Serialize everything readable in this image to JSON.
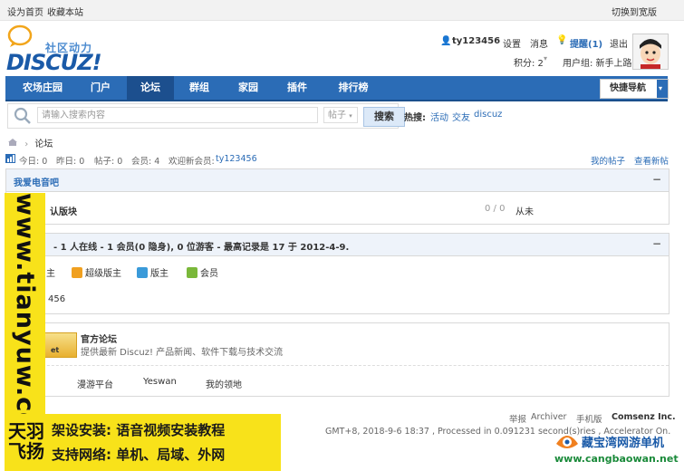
{
  "topbar": {
    "set_home": "设为首页",
    "bookmark": "收藏本站",
    "switch_width": "切换到宽版"
  },
  "header": {
    "logo_subtitle": "社区动力",
    "logo_text": "DISCUZ!",
    "username": "ty123456",
    "settings": "设置",
    "messages": "消息",
    "reminder": "提醒(1)",
    "logout": "退出",
    "points": "积分: 2",
    "usergroup": "用户组: 新手上路"
  },
  "nav": {
    "items": [
      {
        "label": "农场庄园"
      },
      {
        "label": "门户"
      },
      {
        "label": "论坛"
      },
      {
        "label": "群组"
      },
      {
        "label": "家园"
      },
      {
        "label": "插件"
      },
      {
        "label": "排行榜"
      }
    ],
    "active": "论坛",
    "quick_nav": "快捷导航"
  },
  "search": {
    "placeholder": "请输入搜索内容",
    "type": "帖子",
    "button": "搜索",
    "hot_label": "热搜:",
    "hot_words": [
      "活动",
      "交友",
      "discuz"
    ]
  },
  "breadcrumb": {
    "current": "论坛"
  },
  "stats": {
    "today": "今日: 0",
    "yesterday": "昨日: 0",
    "posts": "帖子: 0",
    "members": "会员: 4",
    "welcome": "欢迎新会员:",
    "new_member": "ty123456",
    "my_posts": "我的帖子",
    "new_posts": "查看新帖"
  },
  "forum_box": {
    "title": "我爱电音吧",
    "forum_name": "认版块",
    "counts": "0 / 0",
    "last_post": "从未"
  },
  "online_box": {
    "title": "- 1 人在线 - 1 会员(0 隐身), 0 位游客 - 最高记录是 17 于 2012-4-9.",
    "roles": [
      {
        "label": "超级版主",
        "color": "#f0a020"
      },
      {
        "label": "版主",
        "color": "#3a9ad9"
      },
      {
        "label": "会员",
        "color": "#7ab83a"
      }
    ],
    "role_cutoff": "主",
    "online_user": "456"
  },
  "links_box": {
    "site_title": "官方论坛",
    "site_desc": "提供最新 Discuz! 产品新闻、软件下载与技术交流",
    "links": [
      "漫游平台",
      "Yeswan",
      "我的领地"
    ]
  },
  "footer": {
    "report": "举报",
    "archiver": "Archiver",
    "mobile": "手机版",
    "company": "Comsenz Inc.",
    "time": "GMT+8, 2018-9-6 18:37 , Processed in 0.091231 second(s)",
    "extra": "ries , Accelerator On."
  },
  "overlay": {
    "vertical_url": "www.tianyuw.com",
    "brand": "天羽飞扬",
    "line1": "架设安装: 语音视频安装教程",
    "line2": "支持网络: 单机、局域、外网",
    "watermark_title": "藏宝湾网游单机",
    "watermark_url": "www.cangbaowan.net"
  }
}
